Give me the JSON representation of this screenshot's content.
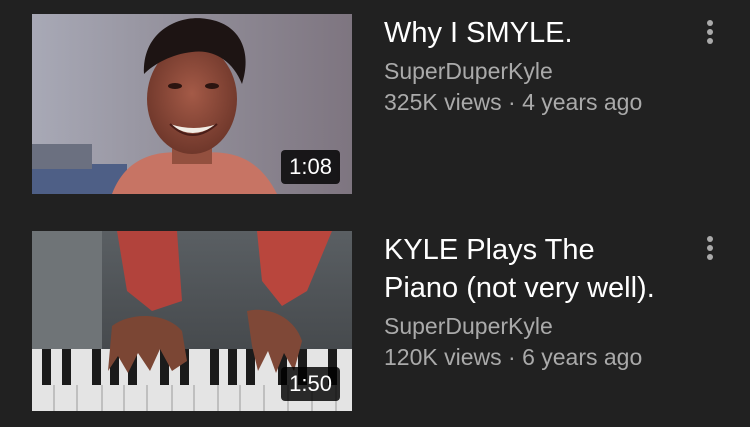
{
  "videos": [
    {
      "title": "Why I SMYLE.",
      "channel": "SuperDuperKyle",
      "views": "325K views",
      "age": "4 years ago",
      "duration": "1:08",
      "thumbnail": "smiling-man-thumbnail"
    },
    {
      "title": "KYLE Plays The Piano (not very well).",
      "channel": "SuperDuperKyle",
      "views": "120K views",
      "age": "6 years ago",
      "duration": "1:50",
      "thumbnail": "piano-hands-thumbnail"
    }
  ],
  "icons": {
    "more": "more-vert-icon"
  },
  "colors": {
    "background": "#212121",
    "title": "#ffffff",
    "secondary_text": "#aaaaaa",
    "duration_badge": "#000000"
  }
}
